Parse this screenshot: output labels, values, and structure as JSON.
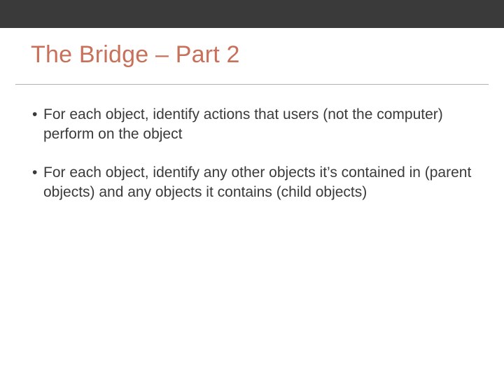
{
  "colors": {
    "topbar": "#3a3a3a",
    "title": "#c8715a",
    "underline": "#b0b0b0",
    "text": "#3a3a3a",
    "background": "#ffffff"
  },
  "title": "The Bridge – Part 2",
  "bullets": [
    {
      "marker": "•",
      "text": "For each object, identify actions that users (not the computer) perform on the object"
    },
    {
      "marker": "•",
      "text": "For each object, identify any other objects it’s contained in (parent objects) and any objects it contains (child objects)"
    }
  ]
}
